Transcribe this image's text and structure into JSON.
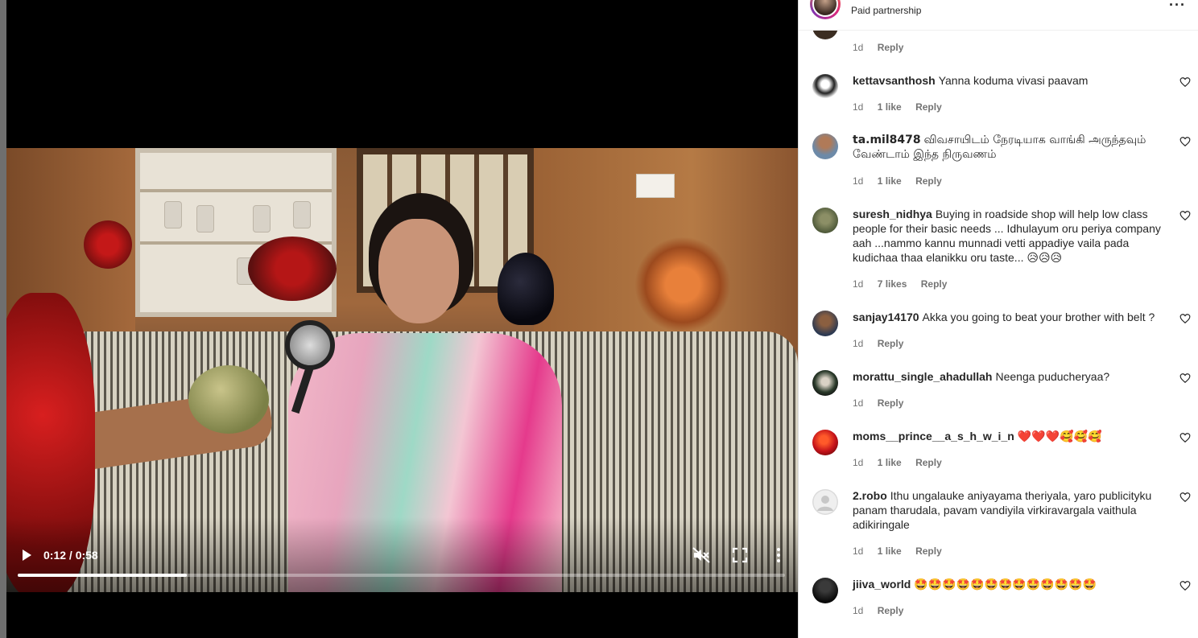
{
  "post_header": {
    "subtitle": "Paid partnership",
    "more": "···"
  },
  "video": {
    "time": "0:12 / 0:58",
    "progress_fraction": 0.22
  },
  "top_comment_meta": {
    "age": "1d",
    "reply": "Reply"
  },
  "comments": [
    {
      "user": "kettavsanthosh",
      "text": "Yanna koduma vivasi paavam",
      "age": "1d",
      "likes": "1 like",
      "reply": "Reply"
    },
    {
      "user": "ta.mil8478",
      "text": "விவசாயிடம் நேரடியாக வாங்கி அருந்தவும் வேண்டாம் இந்த நிருவணம்",
      "age": "1d",
      "likes": "1 like",
      "reply": "Reply"
    },
    {
      "user": "suresh_nidhya",
      "text": "Buying in roadside shop will help low class people for their basic needs ... Idhulayum oru periya company aah ...nammo kannu munnadi vetti appadiye vaila pada kudichaa thaa elanikku oru taste... 😥😥😥",
      "age": "1d",
      "likes": "7 likes",
      "reply": "Reply"
    },
    {
      "user": "sanjay14170",
      "text": "Akka you going to beat your brother with belt ?",
      "age": "1d",
      "likes": "",
      "reply": "Reply"
    },
    {
      "user": "morattu_single_ahadullah",
      "text": "Neenga puducheryaa?",
      "age": "1d",
      "likes": "",
      "reply": "Reply"
    },
    {
      "user": "moms__prince__a_s_h_w_i_n",
      "text": "❤️❤️❤️🥰🥰🥰",
      "age": "1d",
      "likes": "1 like",
      "reply": "Reply"
    },
    {
      "user": "2.robo",
      "text": "Ithu ungalauke aniyayama theriyala, yaro publicityku panam tharudala, pavam vandiyila virkiravargala vaithula adikiringale",
      "age": "1d",
      "likes": "1 like",
      "reply": "Reply"
    },
    {
      "user": "jiiva_world",
      "text": "🤩🤩🤩🤩🤩🤩🤩🤩🤩🤩🤩🤩🤩",
      "age": "1d",
      "likes": "",
      "reply": "Reply"
    }
  ],
  "colors": {
    "accent_progress": "#ffffff",
    "panel_text": "#262626",
    "meta_text": "#737373"
  }
}
